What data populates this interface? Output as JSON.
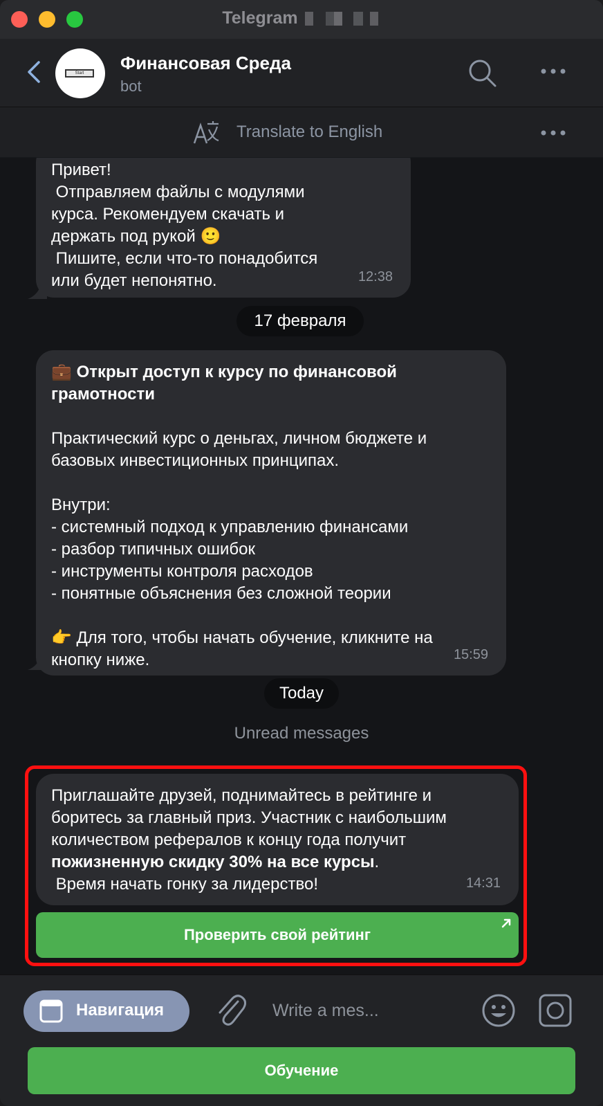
{
  "window": {
    "title": "Telegram"
  },
  "header": {
    "chat_name": "Финансовая Среда",
    "chat_subtitle": "bot",
    "avatar_label": "Start"
  },
  "translate_bar": {
    "label": "Translate to English"
  },
  "messages": [
    {
      "lines": [
        "Привет!",
        " Отправляем файлы с модулями",
        "курса. Рекомендуем скачать и",
        "держать под рукой 🙂",
        " Пишите, если что-то понадобится",
        "или будет непонятно."
      ],
      "time": "12:38"
    },
    {
      "title_emoji": "💼",
      "title_lines": [
        "Открыт доступ к курсу по финансовой",
        "грамотности"
      ],
      "lines": [
        "Практический курс о деньгах, личном бюджете и",
        "базовых инвестиционных принципах.",
        "",
        "Внутри:",
        "- системный подход к управлению финансами",
        "- разбор типичных ошибок",
        "- инструменты контроля расходов",
        "- понятные объяснения без сложной теории",
        "",
        "👉 Для того, чтобы начать обучение, кликните на",
        "кнопку ниже."
      ],
      "time": "15:59"
    },
    {
      "lines": [
        "Приглашайте друзей, поднимайтесь в рейтинге и",
        "боритесь за главный приз. Участник с наибольшим",
        "количеством рефералов к концу года получит"
      ],
      "bold_line": "пожизненную скидку 30% на все курсы",
      "bold_suffix": ".",
      "last_line": " Время начать гонку за лидерство!",
      "time": "14:31",
      "button": "Проверить свой рейтинг"
    }
  ],
  "dates": {
    "first": "17 февраля",
    "second": "Today"
  },
  "unread_label": "Unread messages",
  "composer": {
    "menu_button": "Навигация",
    "placeholder": "Write a mes...",
    "keyboard_button": "Обучение"
  },
  "colors": {
    "accent_green": "#4caf50",
    "highlight_red": "#ff1010",
    "menu_button_bg": "#8795b3"
  }
}
